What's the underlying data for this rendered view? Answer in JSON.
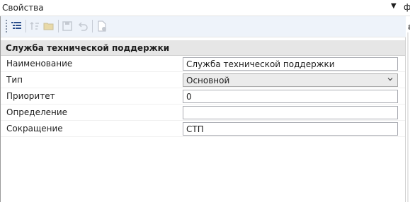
{
  "window": {
    "title": "Свойства",
    "menu_glyph": "▼",
    "overflow_glyph": "ф",
    "side_glyph": "⇟"
  },
  "toolbar": {
    "buttons": [
      {
        "name": "categorized-icon",
        "enabled": true
      },
      {
        "name": "sort-icon",
        "enabled": false
      },
      {
        "name": "folder-icon",
        "enabled": false
      },
      {
        "name": "save-icon",
        "enabled": false
      },
      {
        "name": "undo-icon",
        "enabled": false
      },
      {
        "name": "new-document-icon",
        "enabled": false
      }
    ]
  },
  "properties": {
    "group_title": "Служба технической поддержки",
    "rows": [
      {
        "label": "Наименование",
        "value": "Служба технической поддержки",
        "type": "text"
      },
      {
        "label": "Тип",
        "value": "Основной",
        "type": "combo"
      },
      {
        "label": "Приоритет",
        "value": "0",
        "type": "text"
      },
      {
        "label": "Определение",
        "value": "",
        "type": "text"
      },
      {
        "label": "Сокращение",
        "value": "СТП",
        "type": "text"
      }
    ]
  },
  "colors": {
    "toolbar_bg": "#eef3fa",
    "group_header_bg": "#e6e6e6",
    "icon_active": "#2b4f8c",
    "icon_disabled": "#c4c9d1"
  }
}
